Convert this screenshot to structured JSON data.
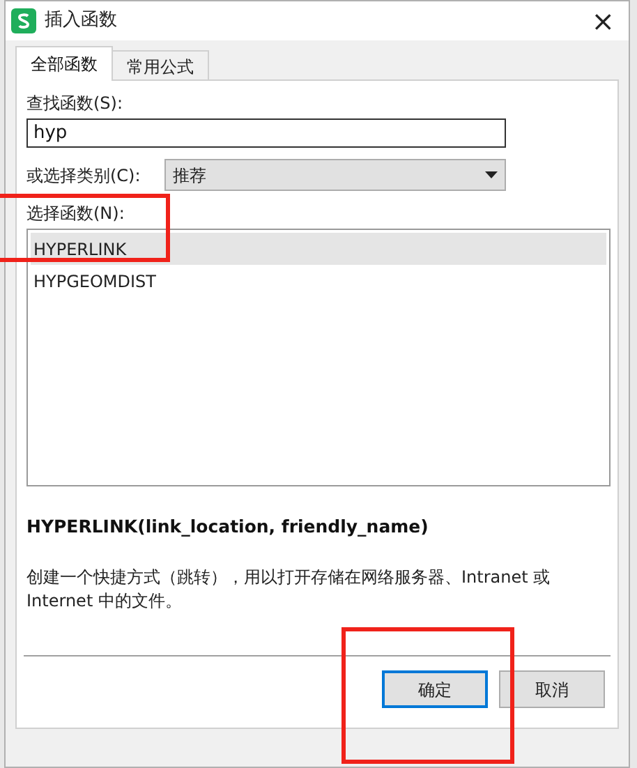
{
  "window": {
    "title": "插入函数",
    "close": "×"
  },
  "tabs": [
    {
      "label": "全部函数",
      "selected": true
    },
    {
      "label": "常用公式",
      "selected": false
    }
  ],
  "search": {
    "label": "查找函数(S):",
    "value": "hyp"
  },
  "category": {
    "label": "或选择类别(C):",
    "value": "推荐"
  },
  "function_list": {
    "label": "选择函数(N):",
    "items": [
      {
        "label": "HYPERLINK",
        "selected": true
      },
      {
        "label": "HYPGEOMDIST",
        "selected": false
      }
    ]
  },
  "signature": "HYPERLINK(link_location, friendly_name)",
  "description": "创建一个快捷方式（跳转），用以打开存储在网络服务器、Intranet 或 Internet 中的文件。",
  "buttons": [
    {
      "label": "确定",
      "default": true
    },
    {
      "label": "取消",
      "default": false
    }
  ]
}
